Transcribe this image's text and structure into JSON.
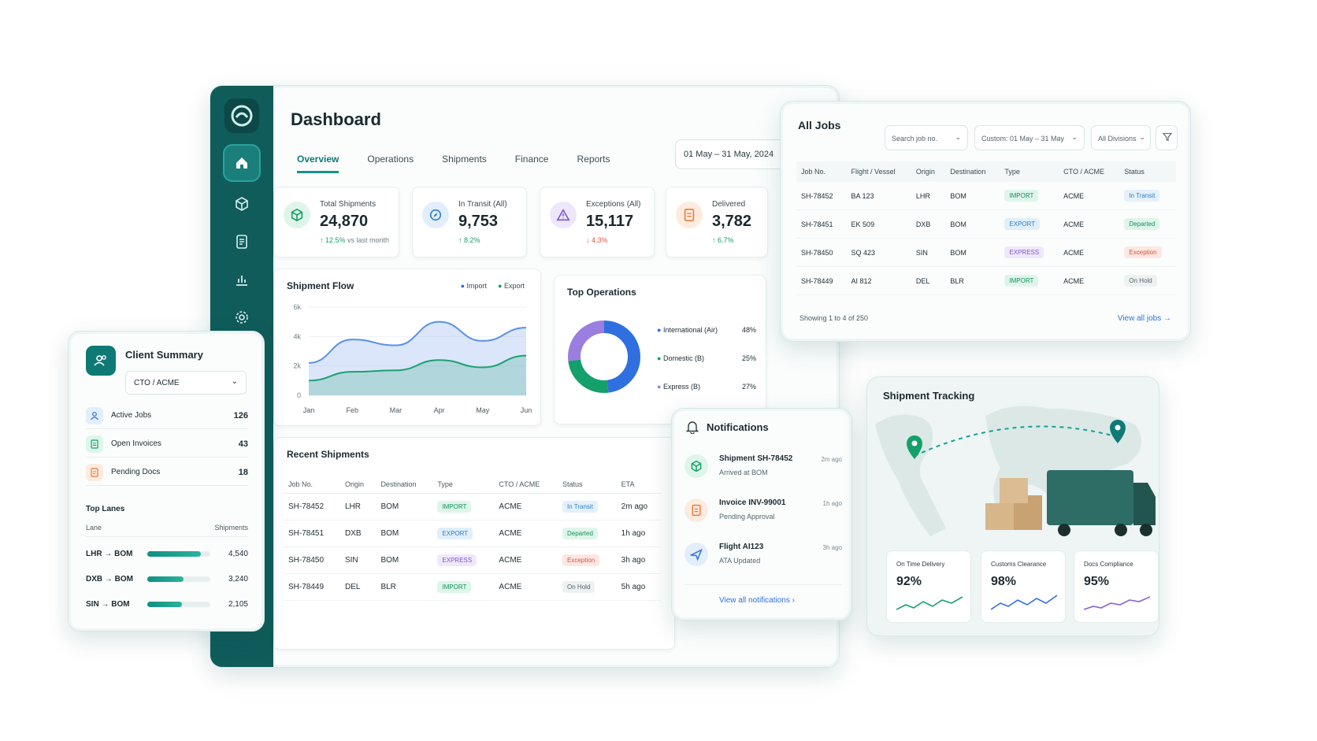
{
  "dashboard": {
    "title": "Dashboard",
    "tabs": [
      "Overview",
      "Operations",
      "Shipments",
      "Finance",
      "Reports"
    ],
    "date_range": "01 May – 31 May, 2024",
    "kpis": [
      {
        "label": "Total Shipments",
        "value": "24,870",
        "trend": "↑ 12.5%",
        "trend_note": "vs last month",
        "direction": "up",
        "icon": "cube-icon",
        "color": "#14a06a"
      },
      {
        "label": "In Transit (All)",
        "value": "9,753",
        "trend": "↑ 8.2%",
        "trend_note": "",
        "direction": "up",
        "icon": "compass-icon",
        "color": "#2f7ec5"
      },
      {
        "label": "Exceptions (All)",
        "value": "15,117",
        "trend": "↓ 4.3%",
        "trend_note": "",
        "direction": "down",
        "icon": "warning-icon",
        "color": "#7d58c8"
      },
      {
        "label": "Delivered",
        "value": "3,782",
        "trend": "↑ 6.7%",
        "trend_note": "",
        "direction": "up",
        "icon": "document-icon",
        "color": "#ef7a3a"
      }
    ],
    "flow": {
      "title": "Shipment Flow",
      "legend_import": "Import",
      "legend_export": "Export"
    },
    "top_ops": {
      "title": "Top Operations",
      "items": [
        {
          "label": "International (Air)",
          "pct": "48%",
          "color": "#2f6fe0"
        },
        {
          "label": "Domestic (B)",
          "pct": "25%",
          "color": "#14a06a"
        },
        {
          "label": "Express (B)",
          "pct": "27%",
          "color": "#9a7ee0"
        }
      ]
    },
    "recent": {
      "title": "Recent Shipments",
      "headers": [
        "Job No.",
        "Origin",
        "Destination",
        "Type",
        "CTO / ACME",
        "Status",
        "ETA"
      ],
      "rows": [
        {
          "job": "SH-78452",
          "origin": "LHR",
          "dest": "BOM",
          "type": "IMPORT",
          "cto": "ACME",
          "status": "In Transit",
          "eta": "2m ago"
        },
        {
          "job": "SH-78451",
          "origin": "DXB",
          "dest": "BOM",
          "type": "EXPORT",
          "cto": "ACME",
          "status": "Departed",
          "eta": "1h ago"
        },
        {
          "job": "SH-78450",
          "origin": "SIN",
          "dest": "BOM",
          "type": "EXPRESS",
          "cto": "ACME",
          "status": "Exception",
          "eta": "3h ago"
        },
        {
          "job": "SH-78449",
          "origin": "DEL",
          "dest": "BLR",
          "type": "IMPORT",
          "cto": "ACME",
          "status": "On Hold",
          "eta": "5h ago"
        }
      ]
    }
  },
  "chart_data": {
    "type": "area",
    "title": "Shipment Flow",
    "categories": [
      "Jan",
      "Feb",
      "Mar",
      "Apr",
      "May",
      "Jun"
    ],
    "ytick_labels": [
      "0",
      "2k",
      "4k",
      "6k"
    ],
    "ylim": [
      0,
      6000
    ],
    "series": [
      {
        "name": "Import",
        "values": [
          2200,
          3800,
          3400,
          5000,
          3700,
          4600
        ],
        "color": "#5b8fe8"
      },
      {
        "name": "Export",
        "values": [
          1000,
          1600,
          1700,
          2400,
          1900,
          2700
        ],
        "color": "#1aa172"
      }
    ],
    "legend": "top-right"
  },
  "alljobs": {
    "title": "All Jobs",
    "search_placeholder": "Search job no.",
    "date_filter": "Custom: 01 May – 31 May",
    "division_filter": "All Divisions",
    "headers": [
      "Job No.",
      "Flight / Vessel",
      "Origin",
      "Destination",
      "Type",
      "CTO / ACME",
      "Status"
    ],
    "rows": [
      {
        "job": "SH-78452",
        "flight": "BA 123",
        "origin": "LHR",
        "dest": "BOM",
        "type": "IMPORT",
        "cto": "ACME",
        "status": "In Transit"
      },
      {
        "job": "SH-78451",
        "flight": "EK 509",
        "origin": "DXB",
        "dest": "BOM",
        "type": "EXPORT",
        "cto": "ACME",
        "status": "Departed"
      },
      {
        "job": "SH-78450",
        "flight": "SQ 423",
        "origin": "SIN",
        "dest": "BOM",
        "type": "EXPRESS",
        "cto": "ACME",
        "status": "Exception"
      },
      {
        "job": "SH-78449",
        "flight": "AI 812",
        "origin": "DEL",
        "dest": "BLR",
        "type": "IMPORT",
        "cto": "ACME",
        "status": "On Hold"
      }
    ],
    "showing": "Showing 1 to 4 of 250",
    "view_all": "View all jobs"
  },
  "client": {
    "title": "Client Summary",
    "selector": "CTO / ACME",
    "rows": [
      {
        "label": "Active Jobs",
        "value": "126"
      },
      {
        "label": "Open Invoices",
        "value": "43"
      },
      {
        "label": "Pending Docs",
        "value": "18"
      }
    ],
    "lanes_title": "Top Lanes",
    "lane_header": "Lane",
    "shipments_header": "Shipments",
    "lanes": [
      {
        "lane": "LHR → BOM",
        "value": "4,540",
        "fraction": 0.85
      },
      {
        "lane": "DXB → BOM",
        "value": "3,240",
        "fraction": 0.58
      },
      {
        "lane": "SIN → BOM",
        "value": "2,105",
        "fraction": 0.55
      }
    ]
  },
  "notifications": {
    "title": "Notifications",
    "items": [
      {
        "title": "Shipment SH-78452",
        "sub": "Arrived at BOM",
        "time": "2m ago",
        "icon": "cube-icon"
      },
      {
        "title": "Invoice INV-99001",
        "sub": "Pending Approval",
        "time": "1h ago",
        "icon": "invoice-icon"
      },
      {
        "title": "Flight AI123",
        "sub": "ATA Updated",
        "time": "3h ago",
        "icon": "plane-icon"
      }
    ],
    "view_all": "View all notifications"
  },
  "tracking": {
    "title": "Shipment Tracking",
    "stats": [
      {
        "label": "On Time Delivery",
        "value": "92%",
        "color": "#14a06a"
      },
      {
        "label": "Customs Clearance",
        "value": "98%",
        "color": "#2f6fe0"
      },
      {
        "label": "Docs Compliance",
        "value": "95%",
        "color": "#8a63d2"
      }
    ]
  }
}
